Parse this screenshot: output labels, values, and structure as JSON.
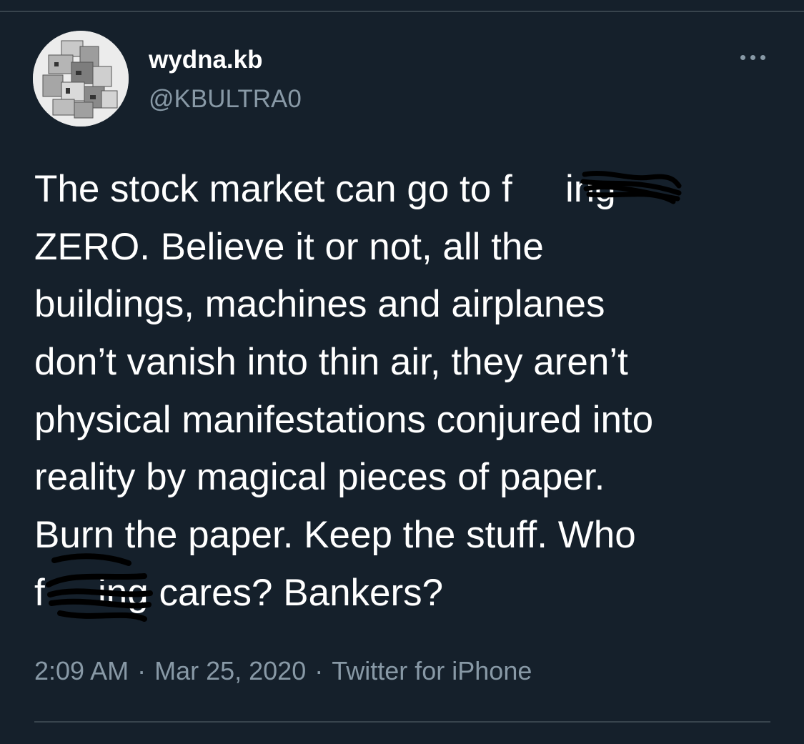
{
  "tweet": {
    "author": {
      "display_name": "wydna.kb",
      "handle": "@KBULTRA0"
    },
    "more_icon": "more-horizontal-icon",
    "text_lines": [
      "The stock market can go to f       ing",
      "ZERO. Believe it or not, all the",
      "buildings, machines and airplanes",
      "don’t vanish into thin air, they aren’t",
      "physical manifestations conjured into",
      "reality by magical pieces of paper.",
      "Burn the paper. Keep the stuff. Who",
      "f       ing cares? Bankers?"
    ],
    "time": "2:09 AM",
    "separator": "·",
    "date": "Mar 25, 2020",
    "source": "Twitter for iPhone"
  },
  "colors": {
    "background": "#15202b",
    "text": "#ffffff",
    "secondary": "#8899a6",
    "divider": "#38444d",
    "redaction": "#000000"
  }
}
